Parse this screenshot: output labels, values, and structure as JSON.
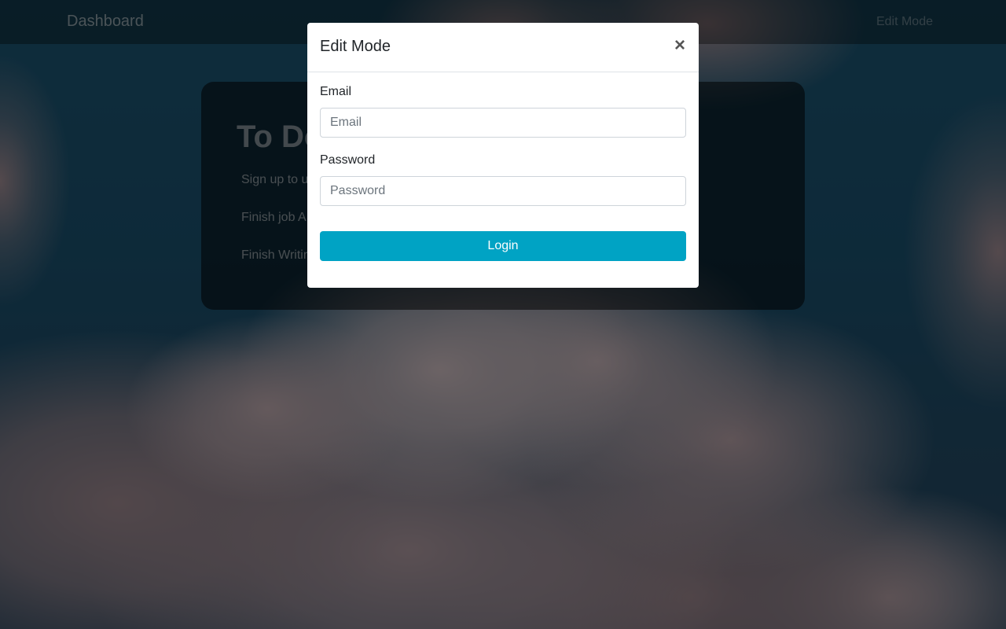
{
  "navbar": {
    "brand": "Dashboard",
    "edit_mode_link": "Edit Mode"
  },
  "todo": {
    "title": "To Do",
    "items": [
      "Sign up to u",
      "Finish job A",
      "Finish Writin"
    ]
  },
  "modal": {
    "title": "Edit Mode",
    "close_symbol": "×",
    "email": {
      "label": "Email",
      "placeholder": "Email",
      "value": ""
    },
    "password": {
      "label": "Password",
      "placeholder": "Password",
      "value": ""
    },
    "login_label": "Login"
  },
  "colors": {
    "accent": "#00a3c4",
    "modal_bg": "#ffffff",
    "overlay": "rgba(0,0,0,0.5)"
  }
}
